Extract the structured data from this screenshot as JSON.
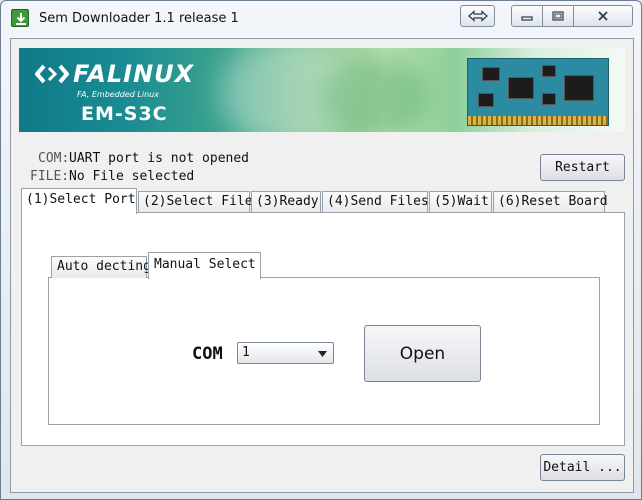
{
  "window": {
    "title": "Sem Downloader 1.1 release 1"
  },
  "banner": {
    "brand": "FALINUX",
    "tagline": "FA, Embedded Linux",
    "model": "EM-S3C"
  },
  "status": {
    "com_label": "COM:",
    "com_value": "UART port is not opened",
    "file_label": "FILE:",
    "file_value": "No File selected",
    "restart_label": "Restart"
  },
  "steps": {
    "tabs": [
      {
        "label": "(1)Select Port"
      },
      {
        "label": "(2)Select File"
      },
      {
        "label": "(3)Ready"
      },
      {
        "label": "(4)Send Files"
      },
      {
        "label": "(5)Wait"
      },
      {
        "label": "(6)Reset Board"
      }
    ],
    "selected": "(1)Select Port"
  },
  "port": {
    "subtabs": [
      {
        "label": "Auto decting"
      },
      {
        "label": "Manual Select"
      }
    ],
    "selected_subtab": "Manual Select",
    "com_label": "COM",
    "com_value": "1",
    "open_label": "Open"
  },
  "footer": {
    "detail_label": "Detail ..."
  },
  "colors": {
    "title_bar": "#e9eef4",
    "banner_dark": "#0f7a88",
    "banner_light": "#b9dfb2"
  },
  "icons": [
    "download-icon",
    "restore-arrows-icon",
    "minimize-icon",
    "maximize-icon",
    "close-icon",
    "falinux-logo-icon",
    "board-image",
    "dropdown-arrow-icon"
  ]
}
